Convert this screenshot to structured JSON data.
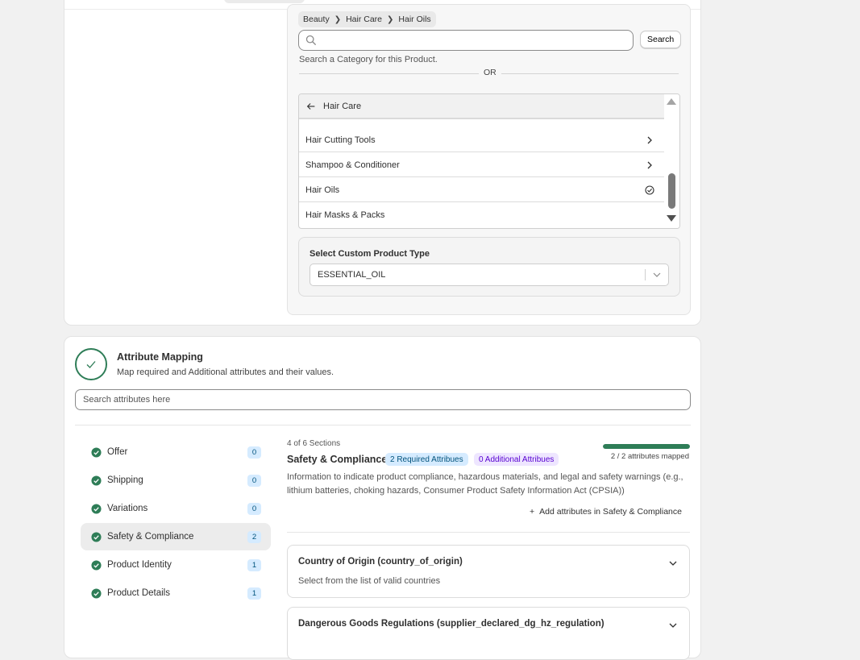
{
  "category": {
    "breadcrumb": [
      "Beauty",
      "Hair Care",
      "Hair Oils"
    ],
    "search_placeholder": "",
    "search_button": "Search",
    "hint": "Search a Category for this Product.",
    "or_label": "OR",
    "list_header": "Hair Care",
    "items": [
      {
        "label": "Hair Cutting Tools",
        "state": "expand"
      },
      {
        "label": "Shampoo & Conditioner",
        "state": "expand"
      },
      {
        "label": "Hair Oils",
        "state": "selected"
      },
      {
        "label": "Hair Masks & Packs",
        "state": "none"
      }
    ],
    "custom_type_label": "Select Custom Product Type",
    "custom_type_value": "ESSENTIAL_OIL"
  },
  "attribute_mapping": {
    "title": "Attribute Mapping",
    "subtitle": "Map required and Additional attributes and their values.",
    "search_placeholder": "Search attributes here",
    "sections": [
      {
        "label": "Offer",
        "count": "0",
        "active": false
      },
      {
        "label": "Shipping",
        "count": "0",
        "active": false
      },
      {
        "label": "Variations",
        "count": "0",
        "active": false
      },
      {
        "label": "Safety & Compliance",
        "count": "2",
        "active": true
      },
      {
        "label": "Product Identity",
        "count": "1",
        "active": false
      },
      {
        "label": "Product Details",
        "count": "1",
        "active": false
      }
    ],
    "detail": {
      "section_progress": "4 of 6 Sections",
      "title": "Safety & Compliance",
      "required_badge": "2 Required Attribues",
      "additional_badge": "0 Additional Attribues",
      "mapped_label": "2 / 2 attributes mapped",
      "mapped_fraction": 1.0,
      "description": "Information to indicate product compliance, hazardous materials, and legal and safety warnings (e.g., lithium batteries, choking hazards, Consumer Product Safety Information Act (CPSIA))",
      "add_label": "Add attributes in Safety & Compliance",
      "attributes": [
        {
          "name": "Country of Origin (country_of_origin)",
          "hint": "Select from the list of valid countries"
        },
        {
          "name": "Dangerous Goods Regulations (supplier_declared_dg_hz_regulation)",
          "hint": ""
        }
      ]
    }
  },
  "colors": {
    "success": "#2e7d57",
    "info_bg": "#d5ebff",
    "info_text": "#00527c",
    "magic_bg": "#eee6ff",
    "magic_text": "#5700d1"
  }
}
